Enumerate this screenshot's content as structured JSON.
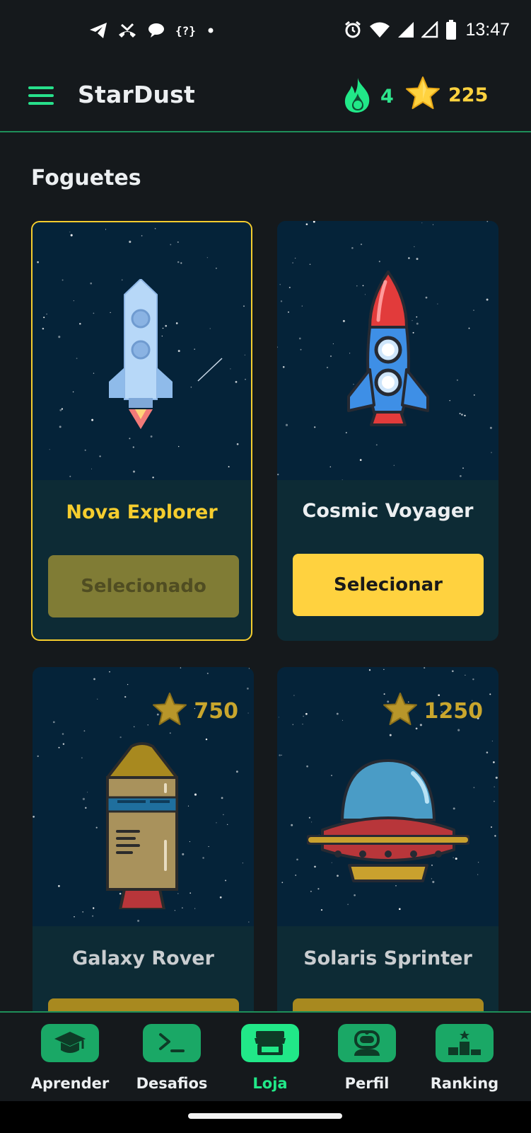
{
  "status_bar": {
    "time": "13:47",
    "left_icons": [
      "telegram-icon",
      "missed-call-icon",
      "chat-bubble-icon",
      "code-braces-icon",
      "dot-icon"
    ],
    "code_glyph": "{?}",
    "right_icons": [
      "alarm-icon",
      "wifi-icon",
      "signal-icon",
      "signal-empty-icon",
      "battery-icon"
    ]
  },
  "header": {
    "title": "StarDust",
    "streak_count": "4",
    "stars_count": "225"
  },
  "section": {
    "title": "Foguetes"
  },
  "rockets": [
    {
      "name": "Nova Explorer",
      "button": "Selecionado",
      "state": "selected",
      "price": null
    },
    {
      "name": "Cosmic Voyager",
      "button": "Selecionar",
      "state": "owned",
      "price": null
    },
    {
      "name": "Galaxy Rover",
      "button": "",
      "state": "locked",
      "price": "750"
    },
    {
      "name": "Solaris Sprinter",
      "button": "",
      "state": "locked",
      "price": "1250"
    }
  ],
  "nav": {
    "items": [
      {
        "label": "Aprender",
        "icon": "graduation-cap-icon",
        "active": false
      },
      {
        "label": "Desafios",
        "icon": "terminal-icon",
        "active": false
      },
      {
        "label": "Loja",
        "icon": "store-icon",
        "active": true
      },
      {
        "label": "Perfil",
        "icon": "astronaut-icon",
        "active": false
      },
      {
        "label": "Ranking",
        "icon": "podium-icon",
        "active": false
      }
    ]
  },
  "colors": {
    "accent_green": "#21e888",
    "gold": "#ffd23f",
    "selected_name": "#f5cd2e",
    "card_bg": "#0d2b35",
    "space_bg": "#052339",
    "background": "#15191c"
  }
}
